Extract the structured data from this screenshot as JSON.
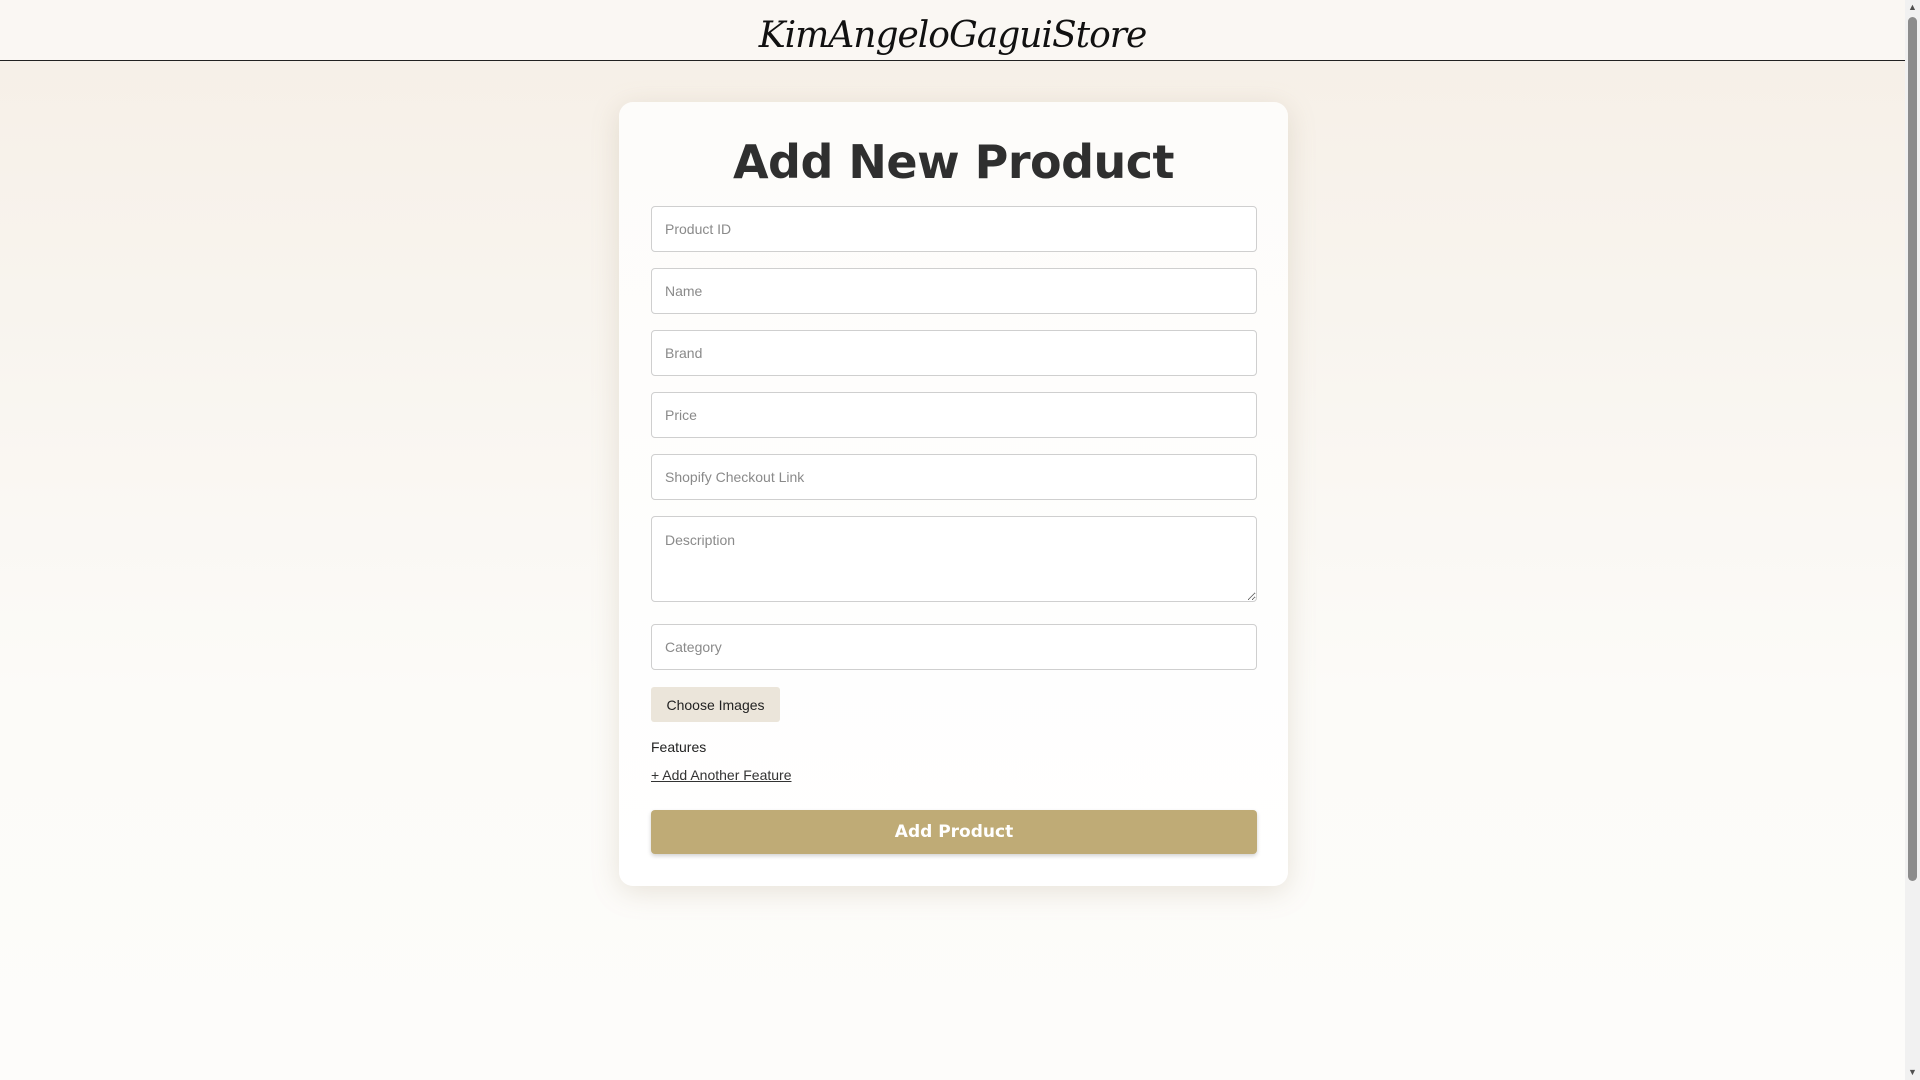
{
  "header": {
    "logo": "KimAngeloGaguiStore"
  },
  "form": {
    "title": "Add New Product",
    "fields": {
      "product_id": {
        "placeholder": "Product ID",
        "value": ""
      },
      "name": {
        "placeholder": "Name",
        "value": ""
      },
      "brand": {
        "placeholder": "Brand",
        "value": ""
      },
      "price": {
        "placeholder": "Price",
        "value": ""
      },
      "checkout_link": {
        "placeholder": "Shopify Checkout Link",
        "value": ""
      },
      "description": {
        "placeholder": "Description",
        "value": ""
      },
      "category": {
        "placeholder": "Category",
        "value": ""
      }
    },
    "choose_images_label": "Choose Images",
    "features_label": "Features",
    "add_feature_label": "+ Add Another Feature",
    "submit_label": "Add Product"
  },
  "colors": {
    "accent": "#bfab76",
    "secondary_button": "#ebe5da",
    "header_border": "#222222"
  },
  "scrollbar": {
    "up_icon": "chevron-up-icon",
    "down_icon": "chevron-down-icon"
  }
}
